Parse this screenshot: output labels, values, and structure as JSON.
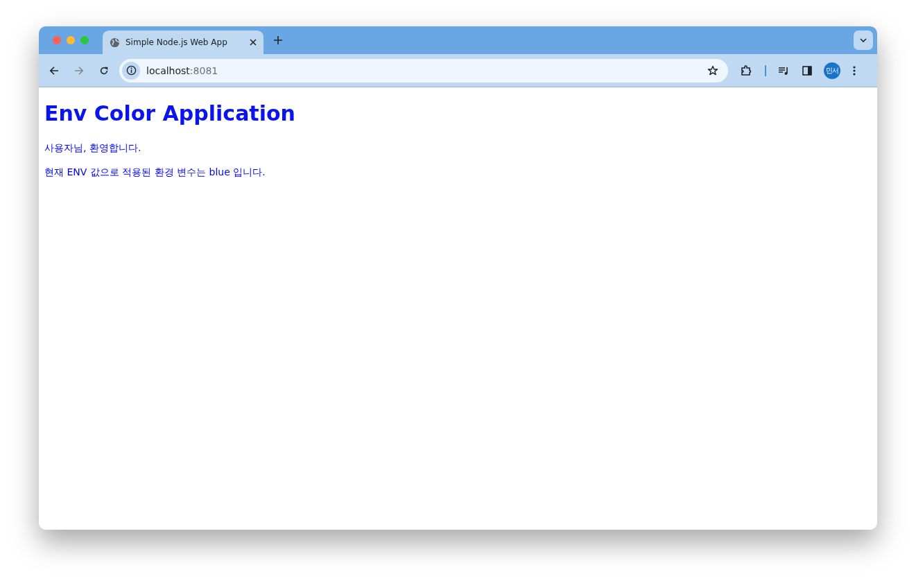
{
  "tab": {
    "title": "Simple Node.js Web App",
    "selected": true
  },
  "address": {
    "host": "localhost",
    "port": ":8081"
  },
  "profile": {
    "initials": "민서"
  },
  "page": {
    "heading": "Env Color Application",
    "paragraphs": [
      "사용자님, 환영합니다.",
      "현재 ENV 값으로 적용된 환경 변수는 blue 입니다."
    ]
  }
}
